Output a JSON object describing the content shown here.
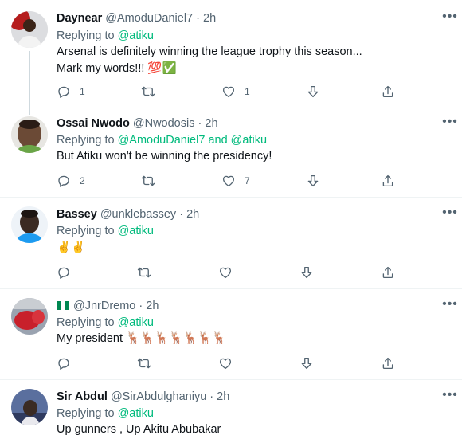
{
  "tweets": [
    {
      "name": "Daynear",
      "handle": "@AmoduDaniel7",
      "time": "2h",
      "reply_prefix": "Replying to",
      "reply_mentions": "@atiku",
      "text_line1": "Arsenal is definitely winning the league trophy this season...",
      "text_line2": "Mark my words!!! 💯✅",
      "replies": "1",
      "retweets": "",
      "likes": "1"
    },
    {
      "name": "Ossai Nwodo",
      "handle": "@Nwodosis",
      "time": "2h",
      "reply_prefix": "Replying to",
      "reply_mentions": "@AmoduDaniel7 and @atiku",
      "text_line1": "But Atiku won't be winning the presidency!",
      "replies": "2",
      "retweets": "",
      "likes": "7"
    },
    {
      "name": "Bassey",
      "handle": "@unklebassey",
      "time": "2h",
      "reply_prefix": "Replying to",
      "reply_mentions": "@atiku",
      "text_line1": "✌️✌️",
      "replies": "",
      "retweets": "",
      "likes": ""
    },
    {
      "name": "",
      "handle": "@JnrDremo",
      "time": "2h",
      "reply_prefix": "Replying to",
      "reply_mentions": "@atiku",
      "text_line1": "My president 🦌🦌🦌🦌🦌🦌🦌",
      "replies": "",
      "retweets": "",
      "likes": ""
    },
    {
      "name": "Sir Abdul",
      "handle": "@SirAbdulghaniyu",
      "time": "2h",
      "reply_prefix": "Replying to",
      "reply_mentions": "@atiku",
      "text_line1": "Up gunners , Up Akitu Abubakar"
    }
  ],
  "separator": "·",
  "icons": {
    "reply": "reply-icon",
    "retweet": "retweet-icon",
    "like": "heart-icon",
    "downvote": "downvote-icon",
    "share": "share-icon",
    "more": "more-icon"
  },
  "colors": {
    "mention": "#00ba7c",
    "secondary_text": "#536471",
    "divider": "#eff3f4"
  }
}
